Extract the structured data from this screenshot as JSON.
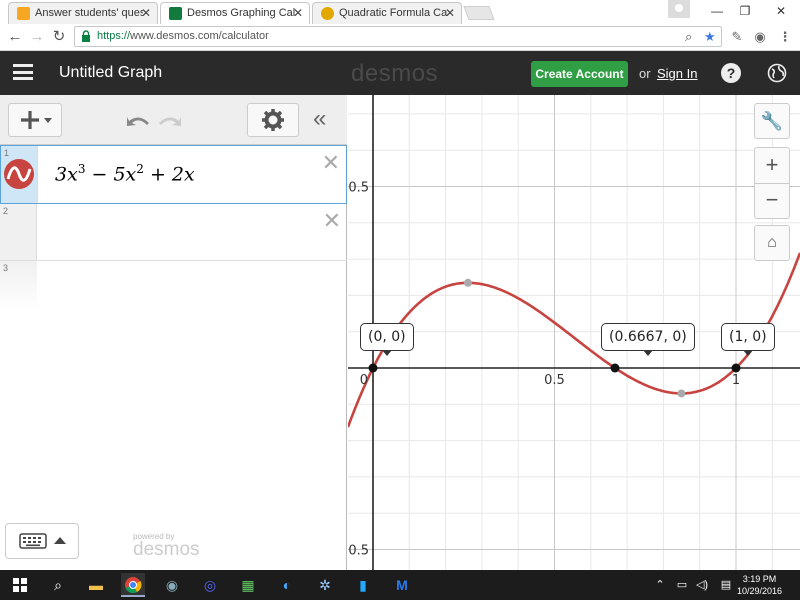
{
  "browser": {
    "tabs": [
      {
        "label": "Answer students' questio",
        "active": false,
        "favicon_color": "#f5a623"
      },
      {
        "label": "Desmos Graphing Calcul",
        "active": true,
        "favicon_color": "#127a3d"
      },
      {
        "label": "Quadratic Formula Calcu",
        "active": false,
        "favicon_color": "#e0a800"
      }
    ],
    "url_scheme": "https://",
    "url_rest": "www.desmos.com/calculator"
  },
  "header": {
    "title": "Untitled Graph",
    "logo": "desmos",
    "create_account": "Create Account",
    "or": "or",
    "sign_in": "Sign In"
  },
  "expressions": [
    {
      "number": "1",
      "latex_parts": [
        "3x",
        "3",
        " − 5x",
        "2",
        " + 2x"
      ]
    },
    {
      "number": "2"
    },
    {
      "number": "3"
    }
  ],
  "powered_by": "powered by",
  "powered_logo": "desmos",
  "graph": {
    "axis_labels": {
      "x_zero": "0",
      "x_half": "0.5",
      "x_one": "1",
      "y_pos": "0.5",
      "y_neg": "-0.5"
    },
    "point_labels": [
      {
        "text": "(0, 0)"
      },
      {
        "text": "(0.6667, 0)"
      },
      {
        "text": "(1, 0)"
      }
    ],
    "curve_color": "#c74440"
  },
  "taskbar": {
    "time": "3:19 PM",
    "date": "10/29/2016"
  }
}
